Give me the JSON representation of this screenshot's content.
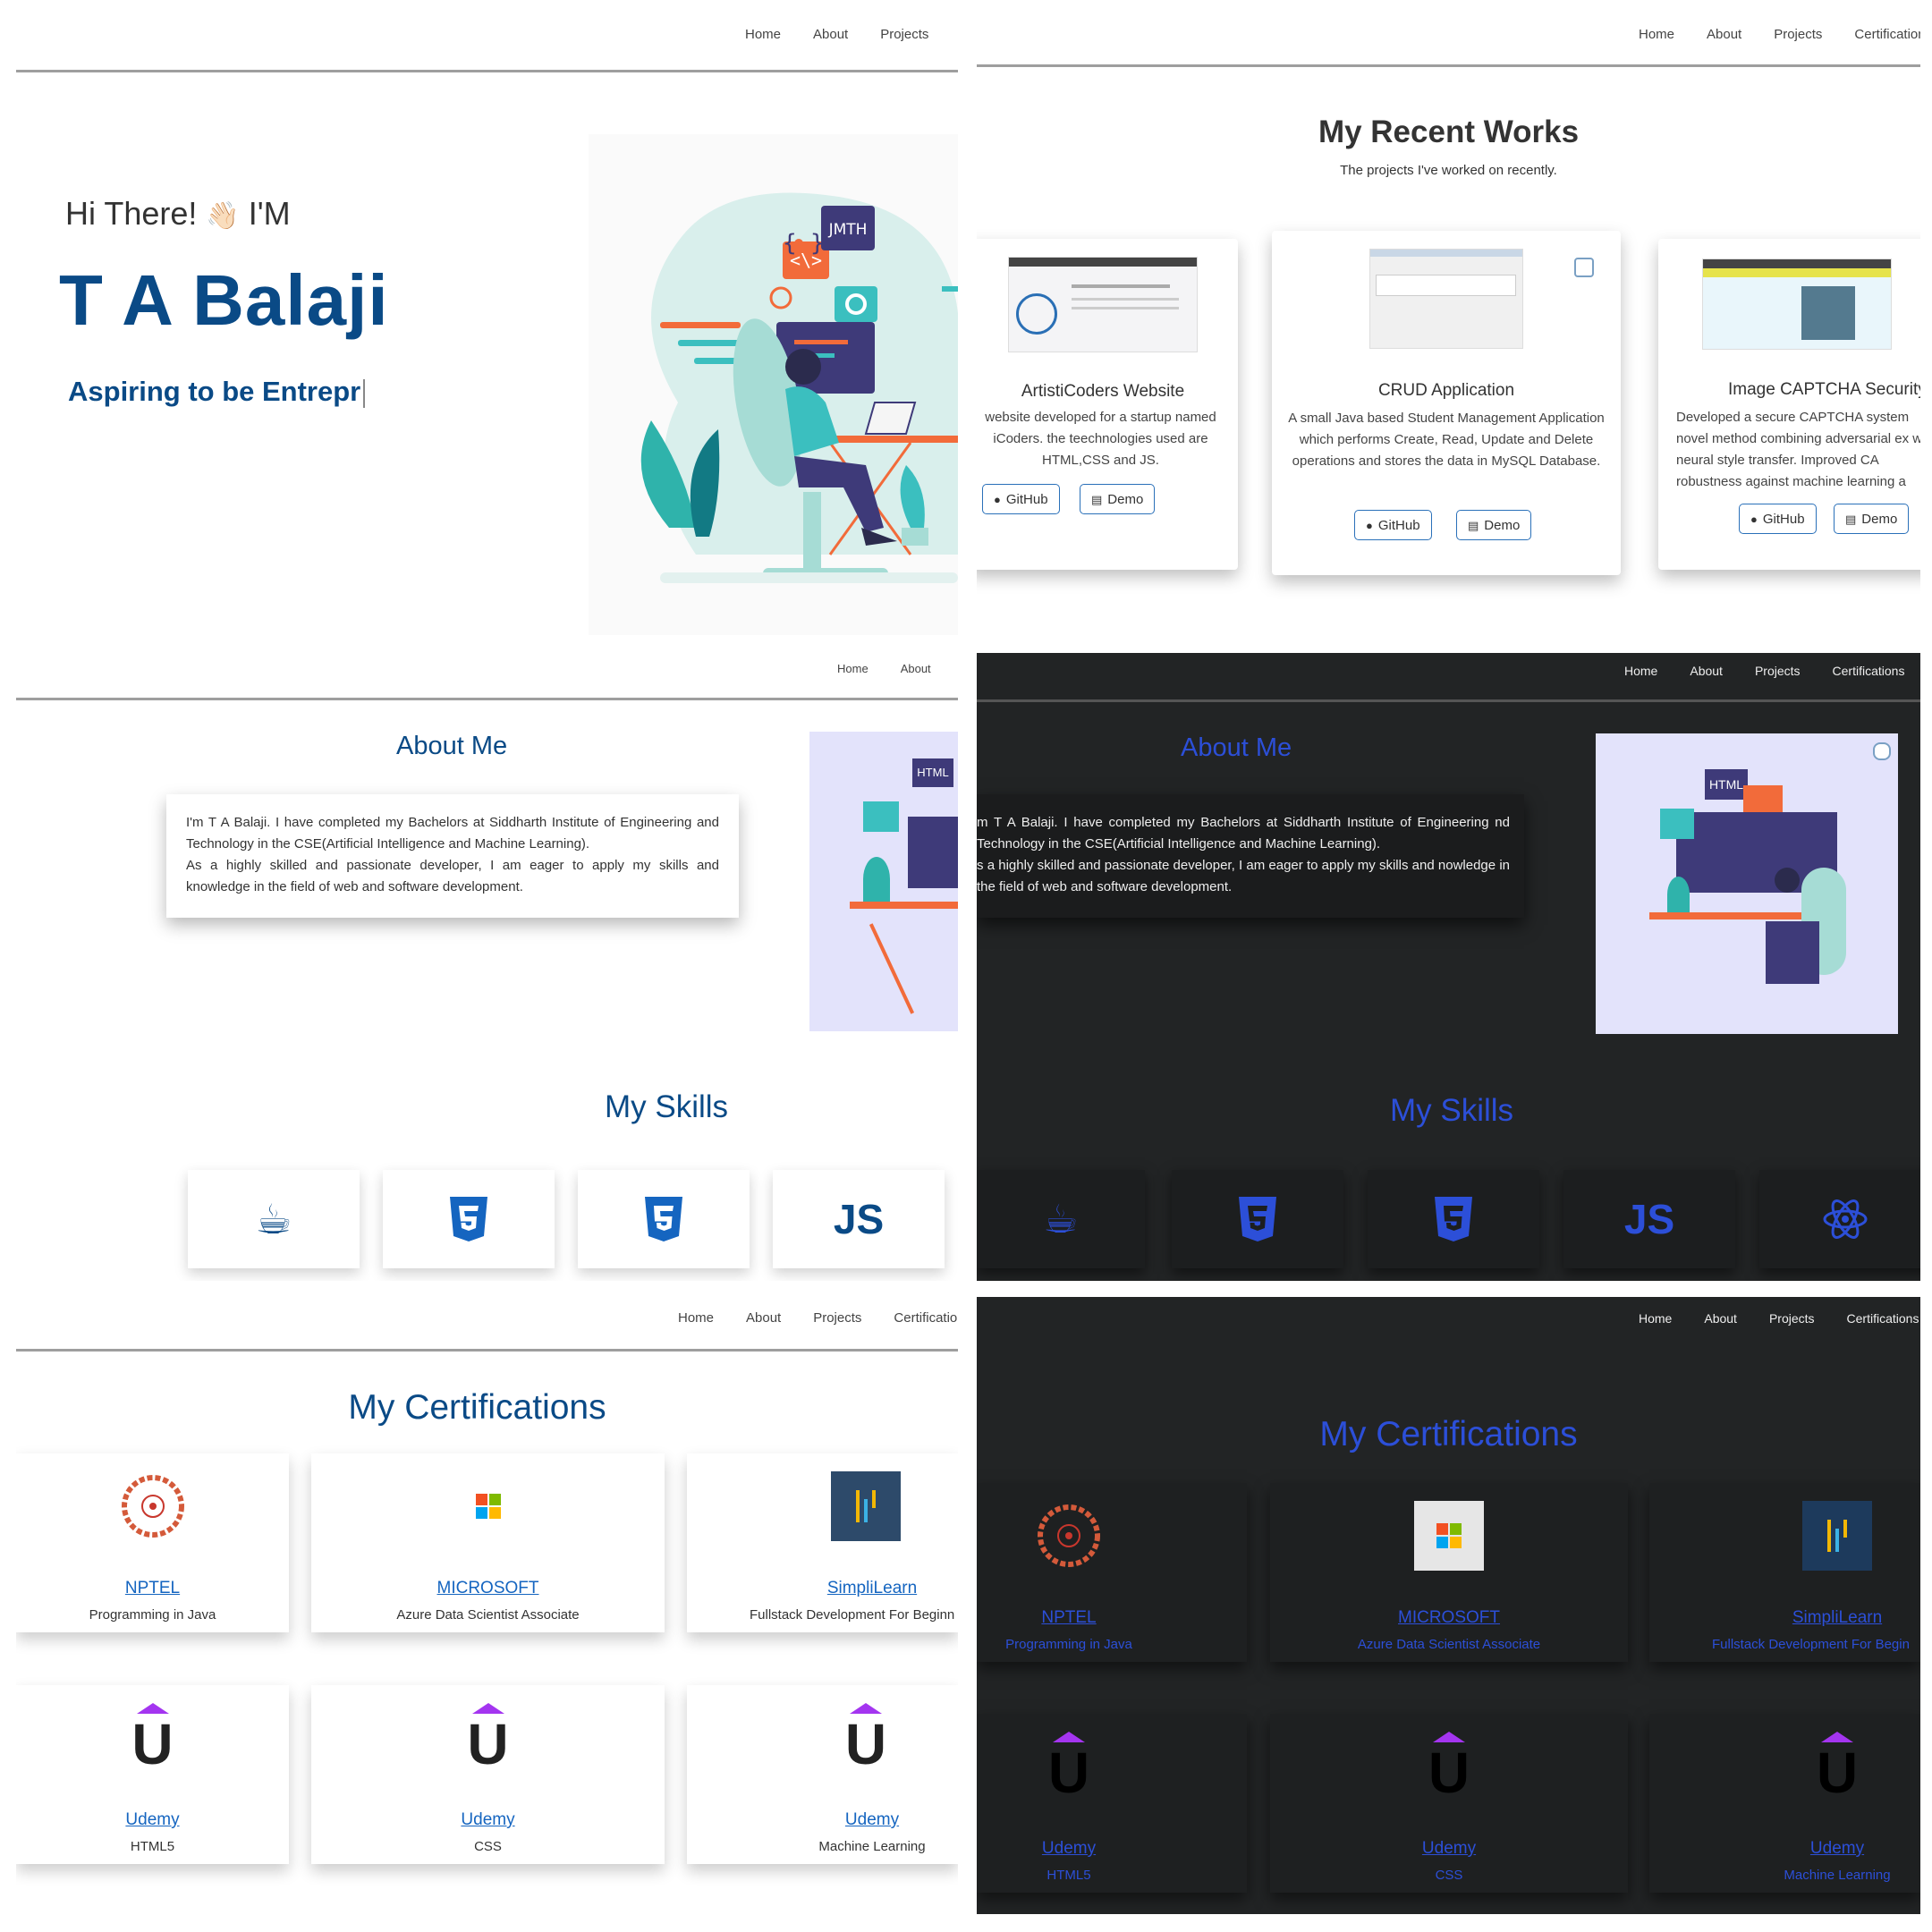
{
  "nav": [
    "Home",
    "About",
    "Projects",
    "Certifications"
  ],
  "hero": {
    "greeting": "Hi There!",
    "wave": "👋🏻",
    "im": "I'M",
    "name": "T A Balaji",
    "typed_text": "Aspiring to be Entrepr"
  },
  "projects": {
    "title": "My Recent Works",
    "subtitle": "The projects I've worked on recently.",
    "items": [
      {
        "title": "ArtistiCoders Website",
        "description": "website developed for a startup named iCoders. the teechnologies used are HTML,CSS and JS.",
        "github": "GitHub",
        "demo": "Demo"
      },
      {
        "title": "CRUD Application",
        "description": "A small Java based Student Management Application which performs Create, Read, Update and Delete operations and stores the data in MySQL Database.",
        "github": "GitHub",
        "demo": "Demo"
      },
      {
        "title": "Image CAPTCHA Security",
        "description": "Developed a secure CAPTCHA system novel method combining adversarial ex with neural style transfer. Improved CA robustness against machine learning a",
        "github": "GitHub",
        "demo": "Demo"
      }
    ]
  },
  "about": {
    "title": "About Me",
    "text1": "I'm T A Balaji. I have completed my Bachelors at Siddharth Institute of Engineering and Technology in the CSE(Artificial Intelligence and Machine Learning).",
    "text2": "As a highly skilled and passionate developer, I am eager to apply my skills and knowledge in the field of web and software development.",
    "text1_dark": "m T A Balaji. I have completed my Bachelors at Siddharth Institute of Engineering nd Technology in the CSE(Artificial Intelligence and Machine Learning).",
    "text2_dark": "s a highly skilled and passionate developer, I am eager to apply my skills and nowledge in the field of web and software development.",
    "illus_badge": "HTML"
  },
  "skills": {
    "title": "My Skills",
    "items": [
      "java-icon",
      "html5-icon",
      "css3-icon",
      "JS",
      "react-icon"
    ],
    "js_label": "JS"
  },
  "certifications": {
    "title": "My Certifications",
    "items": [
      {
        "org": "NPTEL",
        "course": "Programming in Java"
      },
      {
        "org": "MICROSOFT",
        "course": "Azure Data Scientist Associate"
      },
      {
        "org": "SimpliLearn",
        "course": "Fullstack Development For Beginn"
      },
      {
        "org": "Udemy",
        "course": "HTML5"
      },
      {
        "org": "Udemy",
        "course": "CSS"
      },
      {
        "org": "Udemy",
        "course": "Machine Learning"
      }
    ],
    "simplilearn_dark": "Fullstack Development For Begin"
  },
  "colors": {
    "primary": "#0a4a86",
    "dark_accent": "#2c4fd8",
    "dark_bg": "#222425",
    "udemy_purple": "#a435f0"
  }
}
